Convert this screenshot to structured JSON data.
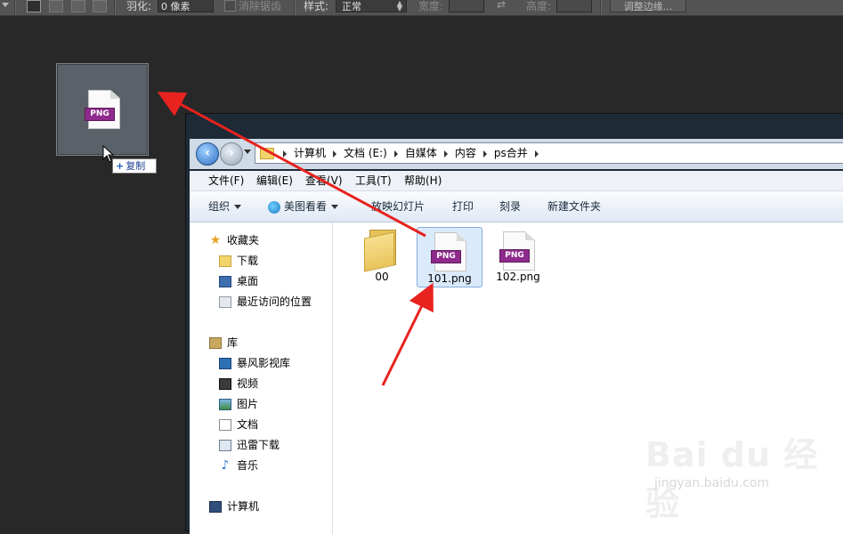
{
  "ps_options": {
    "feather_label": "羽化:",
    "feather_value": "0 像素",
    "antialias_label": "消除锯齿",
    "style_label": "样式:",
    "style_value": "正常",
    "width_label": "宽度:",
    "height_label": "高度:",
    "refine_edge_label": "调整边缘..."
  },
  "drag": {
    "ghost_badge": "PNG",
    "copy_tooltip": "复制"
  },
  "explorer": {
    "breadcrumb": [
      "计算机",
      "文档 (E:)",
      "自媒体",
      "内容",
      "ps合并"
    ],
    "menu": [
      "文件(F)",
      "编辑(E)",
      "查看(V)",
      "工具(T)",
      "帮助(H)"
    ],
    "commands": {
      "organize": "组织",
      "meitu": "美图看看",
      "slideshow": "放映幻灯片",
      "print": "打印",
      "burn": "刻录",
      "new_folder": "新建文件夹"
    },
    "nav": {
      "favorites": "收藏夹",
      "downloads": "下载",
      "desktop": "桌面",
      "recent": "最近访问的位置",
      "libraries": "库",
      "baofeng": "暴风影视库",
      "videos": "视频",
      "pictures": "图片",
      "documents": "文档",
      "xunlei": "迅雷下载",
      "music": "音乐",
      "computer": "计算机"
    },
    "files": [
      {
        "name": "00",
        "type": "folder",
        "selected": false
      },
      {
        "name": "101.png",
        "type": "png",
        "badge": "PNG",
        "selected": true
      },
      {
        "name": "102.png",
        "type": "png",
        "badge": "PNG",
        "selected": false
      }
    ]
  },
  "watermark": {
    "brand": "Bai du 经验",
    "url": "jingyan.baidu.com"
  },
  "colors": {
    "ps_background": "#282828",
    "arrow": "#e8231f",
    "png_badge": "#8e2a8c",
    "selection": "#dbeafb"
  }
}
